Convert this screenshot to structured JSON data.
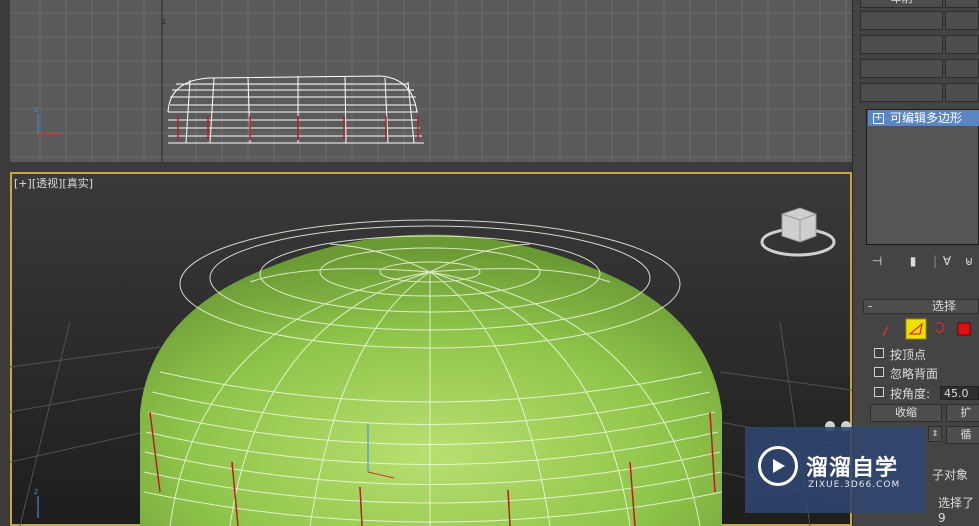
{
  "viewport_top": {
    "axis_label": "z"
  },
  "viewport_persp": {
    "label_plus": "[+]",
    "label_view": "[透视]",
    "label_shade": "[真实]"
  },
  "panel": {
    "top_button": "车削",
    "stack_item": "可编辑多边形",
    "stack_plus": "+",
    "rollout_title": "选择",
    "rollout_collapse": "-",
    "by_vertex": "按顶点",
    "ignore_back": "忽略背面",
    "by_angle": "按角度:",
    "angle_value": "45.0",
    "shrink_button": "收缩",
    "grow_button_partial": "扩",
    "loop_button_partial": "循",
    "subobject_partial": "子对象",
    "selected_partial": "选择了 9"
  },
  "watermark": {
    "title": "溜溜自学",
    "url": "ZIXUE.3D66.COM"
  },
  "colors": {
    "mesh_green": "#8fc44a",
    "viewport_border_active": "#c8a640",
    "modifier_highlight": "#5c86c3"
  }
}
